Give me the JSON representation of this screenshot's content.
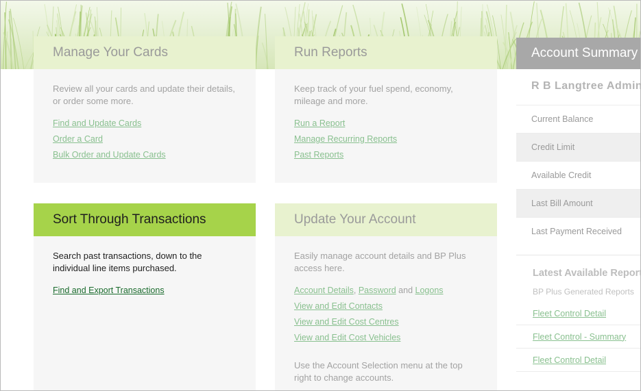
{
  "cards": {
    "manage": {
      "title": "Manage Your Cards",
      "description": "Review all your cards and update their details, or order some more.",
      "links": [
        "Find and Update Cards",
        "Order a Card",
        "Bulk Order and Update Cards"
      ]
    },
    "reports": {
      "title": "Run Reports",
      "description": "Keep track of your fuel spend, economy, mileage and more.",
      "links": [
        "Run a Report",
        "Manage Recurring Reports",
        "Past Reports"
      ]
    },
    "transactions": {
      "title": "Sort Through Transactions",
      "description": "Search past transactions, down to the individual line items purchased.",
      "links": [
        "Find and Export Transactions"
      ]
    },
    "account": {
      "title": "Update Your Account",
      "description": "Easily manage account details and BP Plus access here.",
      "inline": {
        "link1": "Account Details",
        "sep1": ", ",
        "link2": "Password",
        "sep2": " and ",
        "link3": "Logons"
      },
      "links": [
        "View and Edit Contacts",
        "View and Edit Cost Centres",
        "View and Edit Cost Vehicles"
      ],
      "note": "Use the Account Selection menu at the top right to change accounts."
    }
  },
  "summary": {
    "title": "Account Summary",
    "account_name": "R B Langtree Admin",
    "rows": [
      "Current Balance",
      "Credit Limit",
      "Available Credit",
      "Last Bill Amount",
      "Last Payment Received"
    ],
    "latest_title": "Latest Available Reports",
    "latest_sub": "BP Plus Generated Reports",
    "latest_links": [
      "Fleet Control Detail",
      "Fleet Control - Summary",
      "Fleet Control Detail"
    ]
  },
  "colors": {
    "accent": "#a6d34a",
    "link": "#89c08f",
    "active_link": "#1a6b2d",
    "summary_head": "#a8a8a8"
  }
}
